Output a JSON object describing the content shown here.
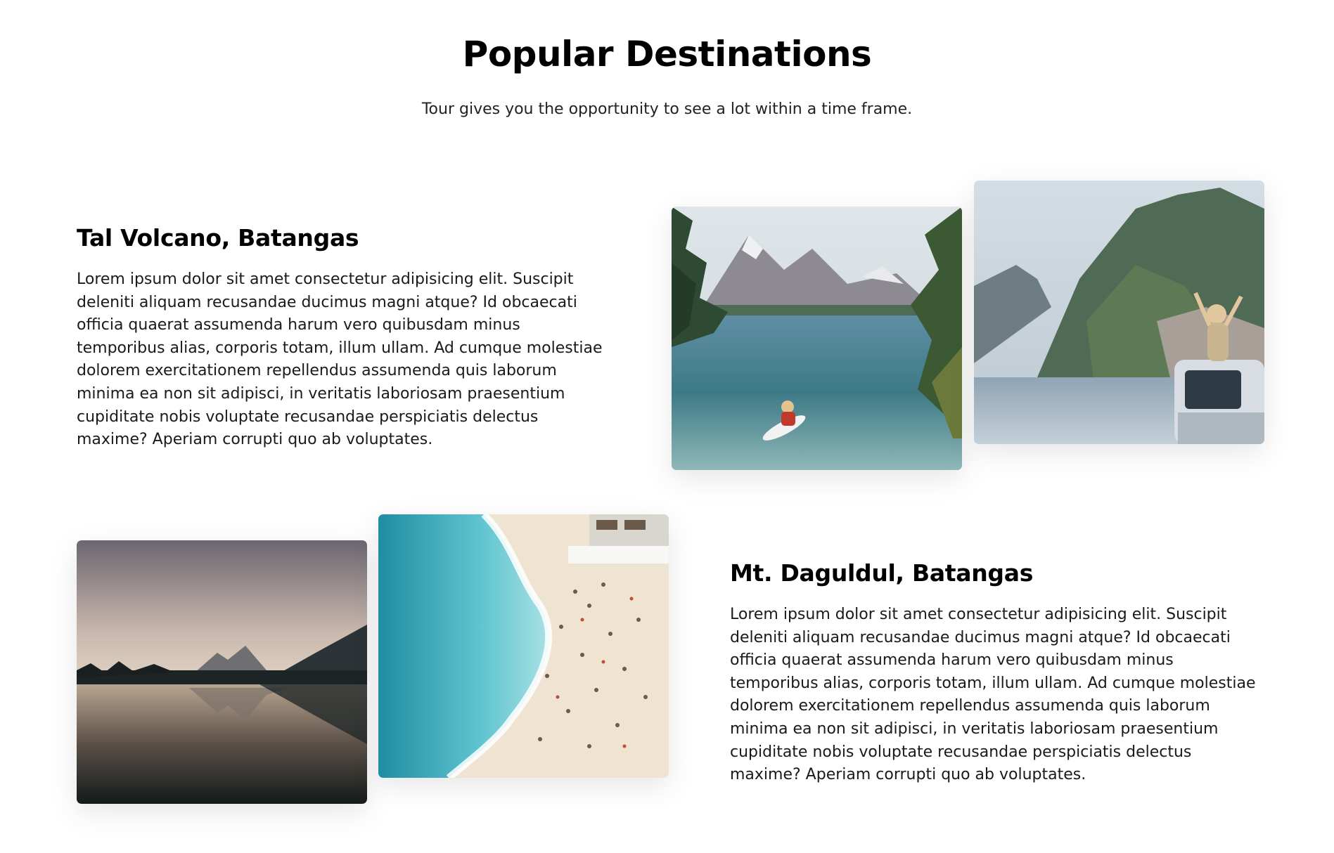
{
  "header": {
    "title": "Popular Destinations",
    "subtitle": "Tour gives you the opportunity to see a lot within a time frame."
  },
  "destinations": [
    {
      "name": "Tal Volcano, Batangas",
      "description": "Lorem ipsum dolor sit amet consectetur adipisicing elit. Suscipit deleniti aliquam recusandae ducimus magni atque? Id obcaecati officia quaerat assumenda harum vero quibusdam minus temporibus alias, corporis totam, illum ullam. Ad cumque molestiae dolorem exercitationem repellendus assumenda quis laborum minima ea non sit adipisci, in veritatis laboriosam praesentium cupiditate nobis voluptate recusandae perspiciatis delectus maxime? Aperiam corrupti quo ab voluptates.",
      "images": [
        "kayak-lake-photo",
        "coastal-mountain-van-photo"
      ]
    },
    {
      "name": "Mt. Daguldul, Batangas",
      "description": "Lorem ipsum dolor sit amet consectetur adipisicing elit. Suscipit deleniti aliquam recusandae ducimus magni atque? Id obcaecati officia quaerat assumenda harum vero quibusdam minus temporibus alias, corporis totam, illum ullam. Ad cumque molestiae dolorem exercitationem repellendus assumenda quis laborum minima ea non sit adipisci, in veritatis laboriosam praesentium cupiditate nobis voluptate recusandae perspiciatis delectus maxime? Aperiam corrupti quo ab voluptates.",
      "images": [
        "lake-sunset-photo",
        "beach-aerial-photo"
      ]
    }
  ]
}
